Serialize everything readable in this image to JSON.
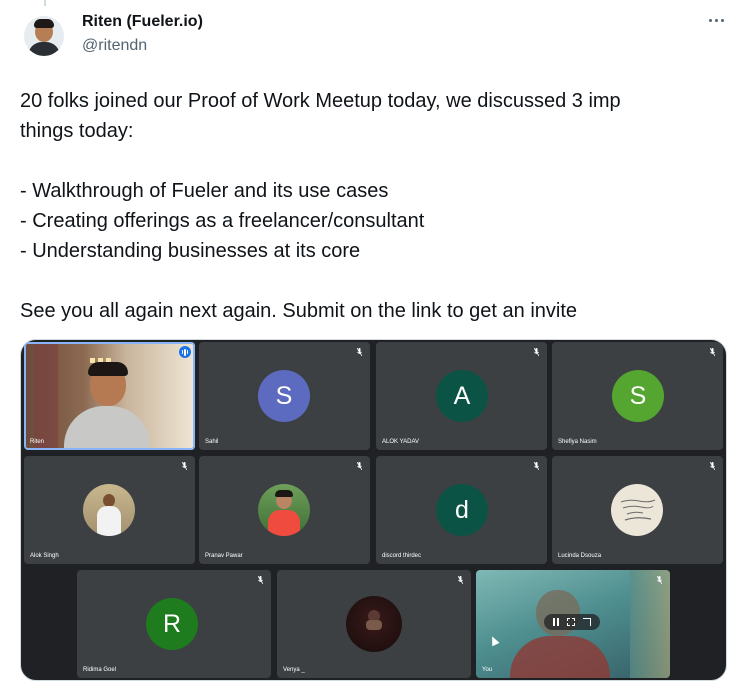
{
  "author": {
    "name": "Riten (Fueler.io)",
    "handle": "@ritendn"
  },
  "tweet": {
    "line1": "20 folks joined our Proof of Work Meetup today, we discussed 3 imp",
    "line2": "things today:",
    "bullet1": "- Walkthrough of Fueler and its use cases",
    "bullet2": "- Creating offerings as a freelancer/consultant",
    "bullet3": "- Understanding businesses at its core",
    "closing": "See you all again next again. Submit on the link to get an invite"
  },
  "meeting": {
    "participants": [
      {
        "name": "Riten",
        "avatar": "video"
      },
      {
        "name": "Sahil",
        "letter": "S",
        "color": "#5c6bc0"
      },
      {
        "name": "ALOK YADAV",
        "letter": "A",
        "color": "#0b5345"
      },
      {
        "name": "Shefiya Nasim",
        "letter": "S",
        "color": "#55a630"
      },
      {
        "name": "Alok Singh",
        "avatar": "photo"
      },
      {
        "name": "Pranav Pawar",
        "avatar": "photo"
      },
      {
        "name": "discord thirdec",
        "letter": "d",
        "color": "#0b5345"
      },
      {
        "name": "Lucinda Dsouza",
        "avatar": "photo"
      },
      {
        "name": "Ridima Goel",
        "letter": "R",
        "color": "#1e7b1e"
      },
      {
        "name": "Venya _",
        "avatar": "photo"
      },
      {
        "name": "You",
        "avatar": "video"
      }
    ]
  }
}
